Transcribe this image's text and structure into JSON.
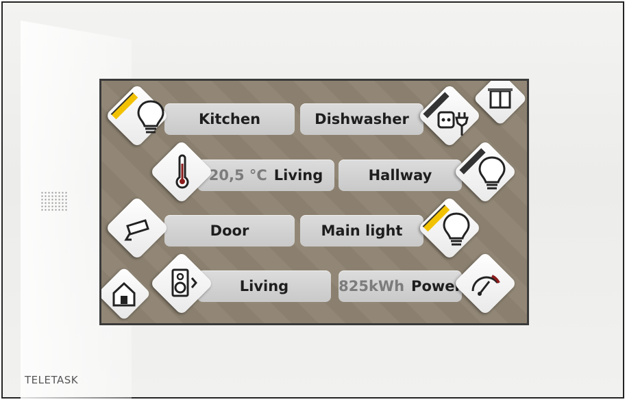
{
  "brand": "TELETASK",
  "colors": {
    "screen_bg": "#8e8372",
    "active_indicator": "#f2c200",
    "inactive_indicator": "#333333"
  },
  "rows": [
    {
      "left": {
        "label": "Kitchen",
        "icon": "light-bulb-icon",
        "state": "on"
      },
      "right": {
        "label": "Dishwasher",
        "icon": "socket-plug-icon",
        "state": "off"
      }
    },
    {
      "left": {
        "value": "20,5 °C",
        "label": "Living",
        "icon": "thermometer-icon"
      },
      "right": {
        "label": "Hallway",
        "icon": "light-bulb-icon",
        "state": "off"
      }
    },
    {
      "left": {
        "label": "Door",
        "icon": "camera-icon"
      },
      "right": {
        "label": "Main light",
        "icon": "light-bulb-icon",
        "state": "on"
      }
    },
    {
      "left": {
        "label": "Living",
        "icon": "speaker-icon"
      },
      "right": {
        "value": "825kWh",
        "label": "Power",
        "icon": "gauge-icon"
      }
    }
  ],
  "nav": {
    "home_icon": "home-icon",
    "menu_icon": "window-icon"
  }
}
